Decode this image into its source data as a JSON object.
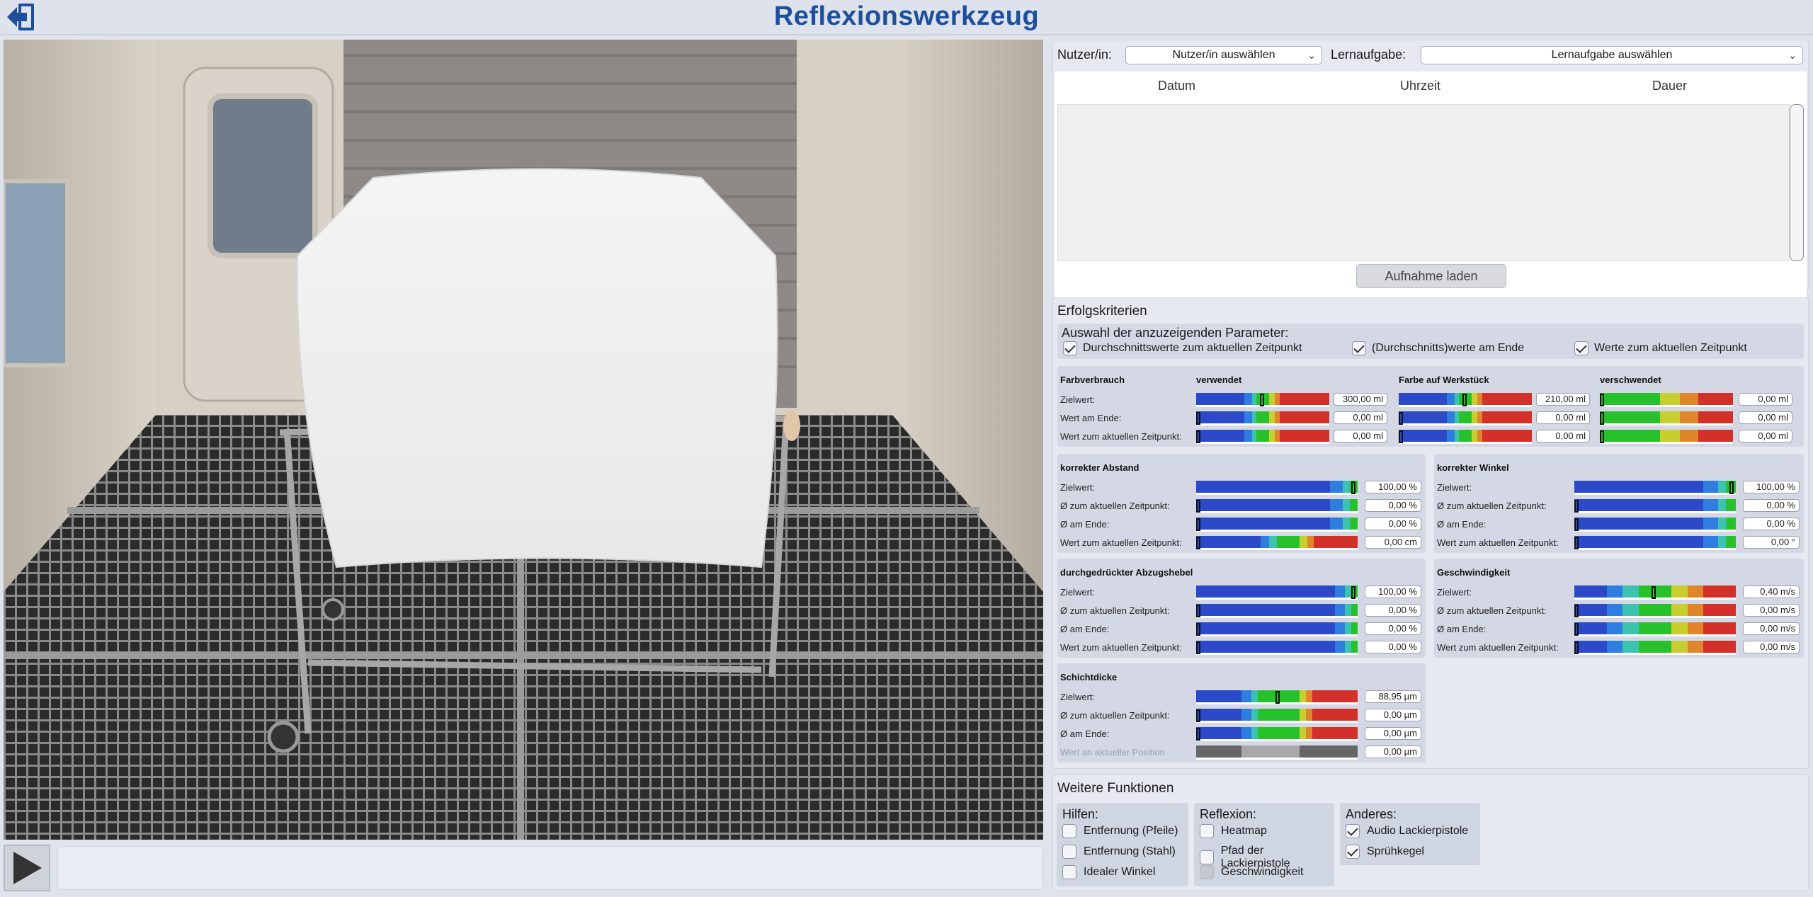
{
  "app": {
    "title": "Reflexionswerkzeug",
    "back_icon": "exit-door-icon"
  },
  "viewport": {
    "scene": "Lackierkabine",
    "play_icon": "play-icon"
  },
  "selection": {
    "user_label": "Nutzer/in:",
    "user_value": "Nutzer/in auswählen",
    "task_label": "Lernaufgabe:",
    "task_value": "Lernaufgabe auswählen"
  },
  "recordings": {
    "columns": [
      "Datum",
      "Uhrzeit",
      "Dauer"
    ],
    "rows": [],
    "load_button": "Aufnahme laden"
  },
  "criteria": {
    "title": "Erfolgskriterien",
    "param_title": "Auswahl der anzuzeigenden Parameter:",
    "params": [
      {
        "label": "Durchschnittswerte zum aktuellen Zeitpunkt",
        "checked": true
      },
      {
        "label": "(Durchschnitts)werte am Ende",
        "checked": true
      },
      {
        "label": "Werte zum aktuellen Zeitpunkt",
        "checked": true
      }
    ],
    "farb": {
      "title": "Farbverbrauch",
      "col1": "verwendet",
      "col2": "Farbe auf Werkstück",
      "col3": "verschwendet",
      "rows": [
        "Zielwert:",
        "Wert am Ende:",
        "Wert zum aktuellen Zeitpunkt:"
      ],
      "v1": [
        "300,00 ml",
        "0,00 ml",
        "0,00 ml"
      ],
      "v2": [
        "210,00 ml",
        "0,00 ml",
        "0,00 ml"
      ],
      "v3": [
        "0,00 ml",
        "0,00 ml",
        "0,00 ml"
      ]
    },
    "abstand": {
      "title": "korrekter Abstand",
      "rows": [
        "Zielwert:",
        "Ø zum aktuellen Zeitpunkt:",
        "Ø am Ende:",
        "Wert zum aktuellen Zeitpunkt:"
      ],
      "values": [
        "100,00 %",
        "0,00 %",
        "0,00 %",
        "0,00 cm"
      ]
    },
    "winkel": {
      "title": "korrekter Winkel",
      "rows": [
        "Zielwert:",
        "Ø zum aktuellen Zeitpunkt:",
        "Ø am Ende:",
        "Wert zum aktuellen Zeitpunkt:"
      ],
      "values": [
        "100,00 %",
        "0,00 %",
        "0,00 %",
        "0,00 °"
      ]
    },
    "hebel": {
      "title": "durchgedrückter Abzugshebel",
      "rows": [
        "Zielwert:",
        "Ø zum aktuellen Zeitpunkt:",
        "Ø am Ende:",
        "Wert zum aktuellen Zeitpunkt:"
      ],
      "values": [
        "100,00 %",
        "0,00 %",
        "0,00 %",
        "0,00 %"
      ]
    },
    "geschw": {
      "title": "Geschwindigkeit",
      "rows": [
        "Zielwert:",
        "Ø zum aktuellen Zeitpunkt:",
        "Ø am Ende:",
        "Wert zum aktuellen Zeitpunkt:"
      ],
      "values": [
        "0,40 m/s",
        "0,00 m/s",
        "0,00 m/s",
        "0,00 m/s"
      ]
    },
    "schicht": {
      "title": "Schichtdicke",
      "rows": [
        "Zielwert:",
        "Ø zum aktuellen Zeitpunkt:",
        "Ø am Ende:",
        "Wert an aktueller Position"
      ],
      "values": [
        "88,95 µm",
        "0,00 µm",
        "0,00 µm",
        "0,00 µm"
      ]
    }
  },
  "functions": {
    "title": "Weitere Funktionen",
    "hilfen": {
      "title": "Hilfen:",
      "items": [
        {
          "label": "Entfernung (Pfeile)",
          "checked": false
        },
        {
          "label": "Entfernung (Stahl)",
          "checked": false
        },
        {
          "label": "Idealer Winkel",
          "checked": false
        }
      ]
    },
    "reflexion": {
      "title": "Reflexion:",
      "items": [
        {
          "label": "Heatmap",
          "checked": false
        },
        {
          "label": "Pfad der Lackierpistole",
          "checked": false
        },
        {
          "label": "Geschwindigkeit",
          "checked": false,
          "disabled": true
        }
      ]
    },
    "anderes": {
      "title": "Anderes:",
      "items": [
        {
          "label": "Audio Lackierpistole",
          "checked": true
        },
        {
          "label": "Sprühkegel",
          "checked": true
        }
      ]
    }
  },
  "colors": {
    "accent": "#1d4f9c",
    "blue": "#2b49c8",
    "green": "#27c22b",
    "red": "#d3302a"
  }
}
